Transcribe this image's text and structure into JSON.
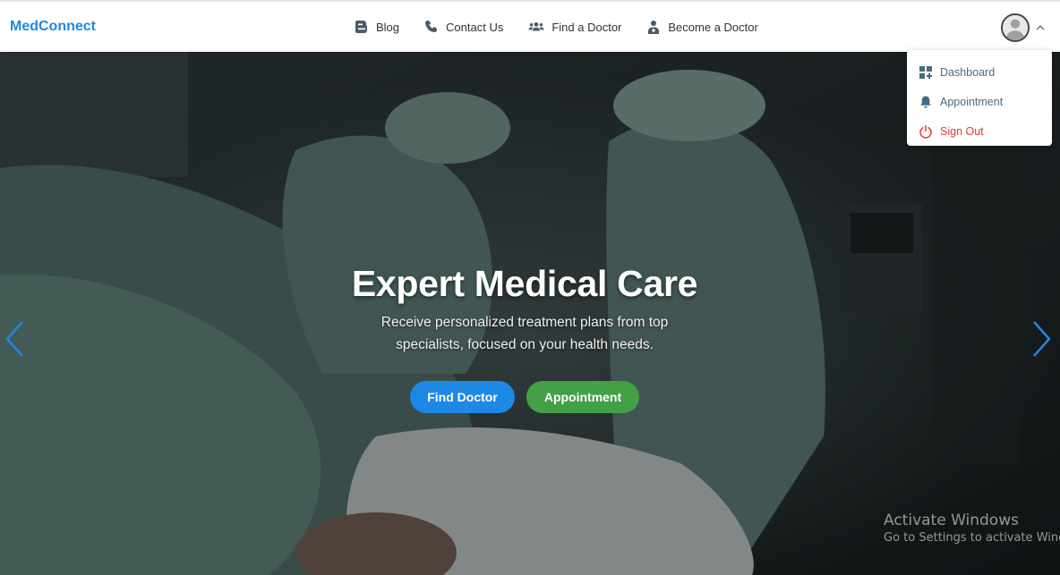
{
  "brand": "MedConnect",
  "nav": {
    "blog": "Blog",
    "contact": "Contact Us",
    "find_doctor": "Find a Doctor",
    "become_doctor": "Become a Doctor"
  },
  "user_menu": {
    "dashboard": "Dashboard",
    "appointment": "Appointment",
    "sign_out": "Sign Out"
  },
  "hero": {
    "title": "Expert Medical Care",
    "subtitle": "Receive personalized treatment plans from top specialists, focused on your health needs.",
    "find_doctor_button": "Find Doctor",
    "appointment_button": "Appointment"
  },
  "watermark": {
    "title": "Activate Windows",
    "subtitle": "Go to Settings to activate Windows."
  },
  "colors": {
    "brand": "#1e88e5",
    "primary_button": "#1e88e5",
    "secondary_button": "#43a047",
    "sign_out": "#e53935",
    "carousel_arrow": "#1e88e5"
  },
  "icons": {
    "blog": "blog-icon",
    "contact": "phone-icon",
    "find_doctor": "users-icon",
    "become_doctor": "doctor-icon",
    "dashboard": "dashboard-icon",
    "appointment": "bell-icon",
    "sign_out": "power-icon"
  }
}
